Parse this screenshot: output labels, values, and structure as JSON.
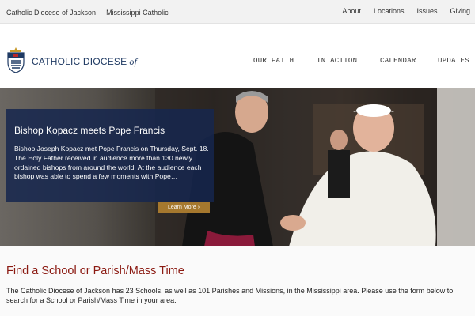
{
  "topbar": {
    "left_links": [
      "Catholic Diocese of Jackson",
      "Mississippi Catholic"
    ],
    "right_links": [
      "About",
      "Locations",
      "Issues",
      "Giving"
    ]
  },
  "header": {
    "brand_name": "CATHOLIC DIOCESE",
    "brand_suffix": "of",
    "nav": [
      "OUR FAITH",
      "IN ACTION",
      "CALENDAR",
      "UPDATES"
    ]
  },
  "hero": {
    "title": "Bishop Kopacz meets Pope Francis",
    "body": "Bishop Joseph Kopacz met Pope Francis on Thursday, Sept. 18. The Holy Father received in audience more than 130 newly ordained bishops from around the world. At the audience each bishop was able to spend a few moments with Pope…",
    "cta": "Learn More ›"
  },
  "find": {
    "heading": "Find a School or Parish/Mass Time",
    "body": "The Catholic Diocese of Jackson has 23 Schools, as well as 101 Parishes and Missions, in the Mississippi area. Please use the form below to search for a School or Parish/Mass Time in your area."
  },
  "colors": {
    "brand_blue": "#1f3a63",
    "caption_bg": "#16264e",
    "cta_gold": "#a5782e",
    "heading_red": "#8b1a12"
  }
}
